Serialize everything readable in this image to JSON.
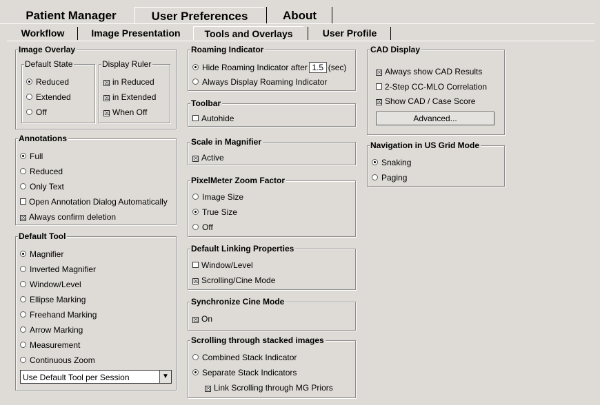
{
  "main_tabs": [
    {
      "label": "Patient Manager"
    },
    {
      "label": "User Preferences"
    },
    {
      "label": "About"
    }
  ],
  "sub_tabs": [
    {
      "label": "Workflow"
    },
    {
      "label": "Image Presentation"
    },
    {
      "label": "Tools and Overlays"
    },
    {
      "label": "User Profile"
    }
  ],
  "image_overlay": {
    "title": "Image Overlay",
    "default_state": {
      "title": "Default State",
      "options": [
        {
          "label": "Reduced",
          "checked": true
        },
        {
          "label": "Extended",
          "checked": false
        },
        {
          "label": "Off",
          "checked": false
        }
      ]
    },
    "display_ruler": {
      "title": "Display Ruler",
      "options": [
        {
          "label": "in Reduced",
          "checked": true
        },
        {
          "label": "in Extended",
          "checked": true
        },
        {
          "label": "When Off",
          "checked": true
        }
      ]
    }
  },
  "annotations": {
    "title": "Annotations",
    "options": [
      {
        "label": "Full",
        "type": "radio",
        "checked": true
      },
      {
        "label": "Reduced",
        "type": "radio",
        "checked": false
      },
      {
        "label": "Only Text",
        "type": "radio",
        "checked": false
      },
      {
        "label": "Open Annotation Dialog Automatically",
        "type": "checkbox",
        "checked": false
      },
      {
        "label": "Always confirm deletion",
        "type": "checkbox",
        "checked": true
      }
    ]
  },
  "default_tool": {
    "title": "Default Tool",
    "options": [
      {
        "label": "Magnifier",
        "checked": true
      },
      {
        "label": "Inverted Magnifier",
        "checked": false
      },
      {
        "label": "Window/Level",
        "checked": false
      },
      {
        "label": "Ellipse Marking",
        "checked": false
      },
      {
        "label": "Freehand Marking",
        "checked": false
      },
      {
        "label": "Arrow Marking",
        "checked": false
      },
      {
        "label": "Measurement",
        "checked": false
      },
      {
        "label": "Continuous Zoom",
        "checked": false
      }
    ],
    "combo_value": "Use Default Tool per Session"
  },
  "roaming": {
    "title": "Roaming Indicator",
    "hide_label": "Hide Roaming Indicator after",
    "value": "1.5",
    "unit": "(sec)",
    "always_label": "Always Display Roaming Indicator"
  },
  "toolbar": {
    "title": "Toolbar",
    "autohide_label": "Autohide"
  },
  "scale_magnifier": {
    "title": "Scale in Magnifier",
    "active_label": "Active"
  },
  "pixelmeter": {
    "title": "PixelMeter Zoom Factor",
    "options": [
      {
        "label": "Image Size",
        "checked": false
      },
      {
        "label": "True Size",
        "checked": true
      },
      {
        "label": "Off",
        "checked": false
      }
    ]
  },
  "linking": {
    "title": "Default Linking Properties",
    "options": [
      {
        "label": "Window/Level",
        "checked": false
      },
      {
        "label": "Scrolling/Cine Mode",
        "checked": true
      }
    ]
  },
  "sync_cine": {
    "title": "Synchronize Cine Mode",
    "on_label": "On"
  },
  "scrolling": {
    "title": "Scrolling through stacked images",
    "combined_label": "Combined Stack Indicator",
    "separate_label": "Separate Stack Indicators",
    "link_label": "Link Scrolling through MG Priors"
  },
  "cad": {
    "title": "CAD Display",
    "options": [
      {
        "label": "Always show CAD Results",
        "checked": true
      },
      {
        "label": "2-Step CC-MLO Correlation",
        "checked": false
      },
      {
        "label": "Show CAD / Case Score",
        "checked": true
      }
    ],
    "advanced_label": "Advanced..."
  },
  "us_grid": {
    "title": "Navigation in US Grid Mode",
    "options": [
      {
        "label": "Snaking",
        "checked": true
      },
      {
        "label": "Paging",
        "checked": false
      }
    ]
  },
  "marks": {
    "check": "☒"
  }
}
